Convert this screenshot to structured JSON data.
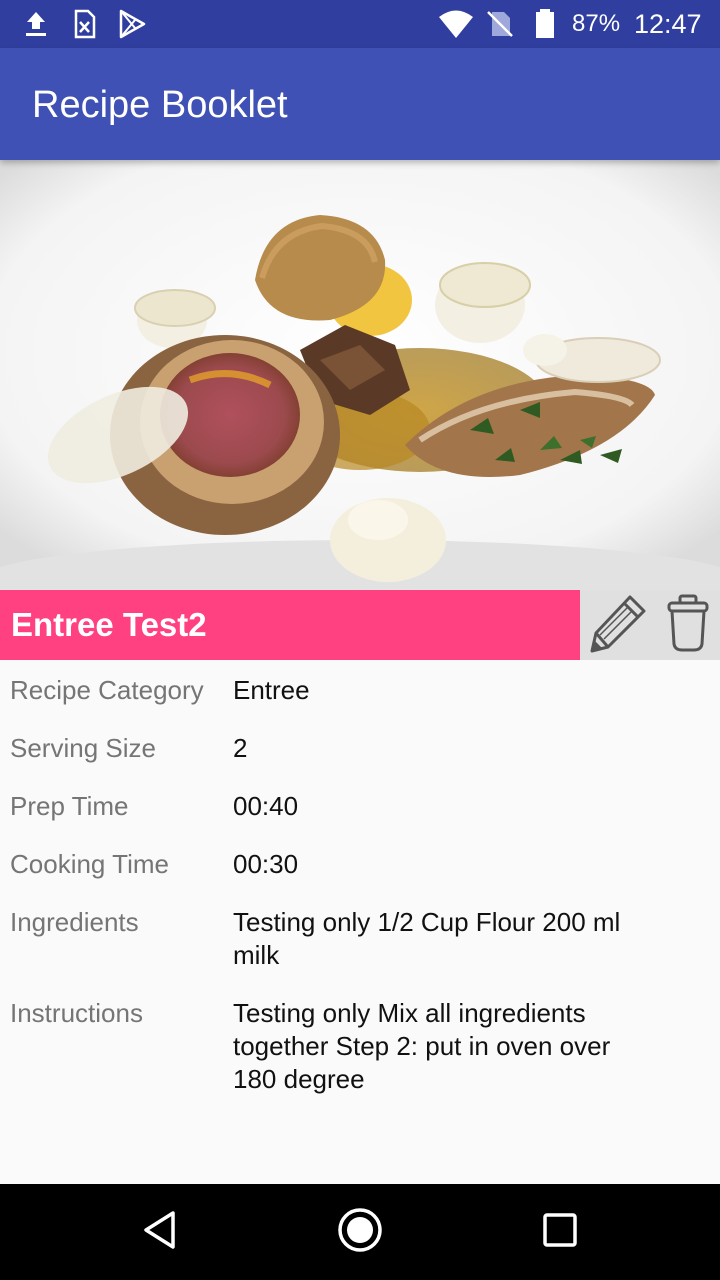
{
  "status_bar": {
    "icons": [
      "upload-icon",
      "sim-card-alert-icon",
      "play-store-icon",
      "wifi-icon",
      "no-sim-icon",
      "battery-icon"
    ],
    "battery": "87%",
    "time": "12:47"
  },
  "app_bar": {
    "title": "Recipe Booklet"
  },
  "recipe": {
    "title": "Entree Test2",
    "details": [
      {
        "label": "Recipe Category",
        "value": "Entree"
      },
      {
        "label": "Serving Size",
        "value": "2"
      },
      {
        "label": "Prep Time",
        "value": "00:40"
      },
      {
        "label": "Cooking Time",
        "value": "00:30"
      },
      {
        "label": "Ingredients",
        "value": "Testing only 1/2 Cup Flour 200 ml milk"
      },
      {
        "label": "Instructions",
        "value": "Testing only Mix all ingredients together Step 2: put in oven over 180 degree"
      }
    ]
  },
  "actions": {
    "edit_icon": "pencil-icon",
    "delete_icon": "trash-icon"
  },
  "nav_bar": {
    "icons": [
      "back-icon",
      "home-icon",
      "recents-icon"
    ]
  },
  "colors": {
    "status_bar": "#303f9f",
    "app_bar": "#3f51b5",
    "accent": "#ff4081",
    "action_bg": "#e0e0e0",
    "label_text": "#757575"
  }
}
